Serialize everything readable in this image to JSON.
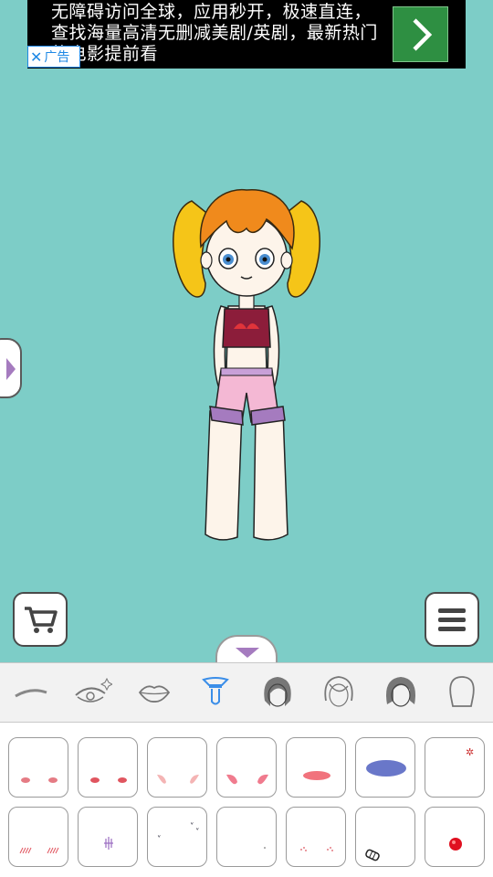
{
  "ad": {
    "text": "无障碍访问全球，应用秒开，极速直连，查找海量高清无删减美剧/英剧，最新热门的电影提前看",
    "badge_close": "✕",
    "badge_label": "广告"
  },
  "toolbar": {
    "cart_icon": "cart-icon",
    "menu_icon": "menu-icon"
  },
  "categories": [
    {
      "name": "eyebrow",
      "selected": false
    },
    {
      "name": "eyes",
      "selected": false
    },
    {
      "name": "lips",
      "selected": false
    },
    {
      "name": "blush",
      "selected": true
    },
    {
      "name": "hair-dark",
      "selected": false
    },
    {
      "name": "hair-outline",
      "selected": false
    },
    {
      "name": "hair-dark-2",
      "selected": false
    },
    {
      "name": "head-outline",
      "selected": false
    }
  ],
  "items": [
    "blush-dots-small",
    "blush-dots-red",
    "blush-petals-light",
    "blush-petals-pink",
    "blush-stripe-red",
    "blush-oval-blue",
    "sparkle-mark",
    "blush-lines",
    "purple-mark",
    "sweat-drops",
    "tiny-dot",
    "blush-freckles",
    "bandage",
    "red-ball"
  ],
  "colors": {
    "background": "#7dcdc7",
    "accent_purple": "#a57bbf",
    "selected_icon": "#3b8ee8"
  }
}
